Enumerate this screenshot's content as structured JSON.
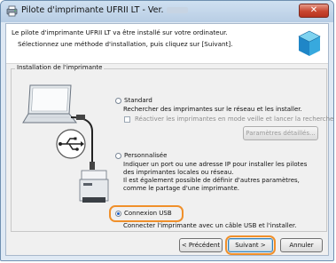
{
  "window": {
    "title": "Pilote d'imprimante UFRII LT - Ver.",
    "close_label": "✕"
  },
  "header": {
    "line1": "Le pilote d'imprimante UFRII LT va être installé sur votre ordinateur.",
    "line2": "Sélectionnez une méthode d'installation, puis cliquez sur [Suivant]."
  },
  "group": {
    "title": "Installation de l'imprimante",
    "standard": {
      "label": "Standard",
      "selected": false,
      "description": "Rechercher des imprimantes sur le réseau et les installer.",
      "checkbox_label": "Réactiver les imprimantes en mode veille et lancer la recherche",
      "checkbox_checked": false,
      "details_button": "Paramètres détaillés..."
    },
    "custom": {
      "label": "Personnalisée",
      "selected": false,
      "description": [
        "Indiquer un port ou une adresse IP pour installer les pilotes",
        "des imprimantes locales ou réseau.",
        "Il est également possible de définir d'autres paramètres,",
        "comme le partage d'une imprimante."
      ]
    },
    "usb": {
      "label": "Connexion USB",
      "selected": true,
      "description": "Connecter l'imprimante avec un câble USB et l'installer."
    }
  },
  "buttons": {
    "back": "< Précédent",
    "next": "Suivant >",
    "cancel": "Annuler"
  },
  "colors": {
    "highlight": "#f0902b",
    "titlebar": "#b8cde4",
    "close": "#c8462f"
  }
}
